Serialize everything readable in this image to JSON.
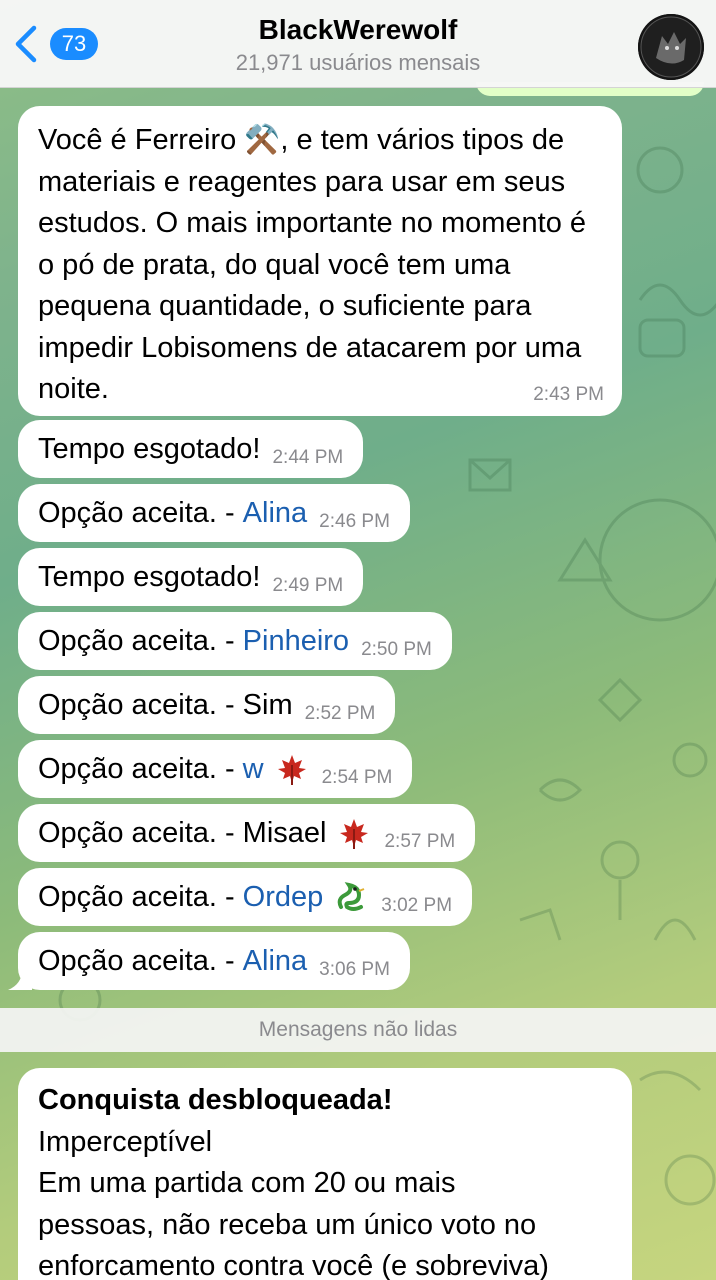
{
  "header": {
    "back_count": "73",
    "title": "BlackWerewolf",
    "subtitle": "21,971 usuários mensais"
  },
  "messages": [
    {
      "text": "Você é Ferreiro ⚒️, e tem vários tipos de materiais e reagentes para usar em seus estudos. O mais importante no momento é o pó de prata, do qual você tem uma pequena quantidade, o suficiente para impedir Lobisomens de atacarem por uma noite.",
      "time": "2:43 PM"
    },
    {
      "text": "Tempo esgotado!",
      "time": "2:44 PM"
    },
    {
      "text": "Opção aceita. -",
      "name": "Alina",
      "time": "2:46 PM"
    },
    {
      "text": "Tempo esgotado!",
      "time": "2:49 PM"
    },
    {
      "text": "Opção aceita. -",
      "name": "Pinheiro",
      "time": "2:50 PM"
    },
    {
      "text": "Opção aceita. -",
      "plain": "Sim",
      "time": "2:52 PM"
    },
    {
      "text": "Opção aceita. -",
      "name": "w",
      "emoji": "maple-leaf-icon",
      "time": "2:54 PM"
    },
    {
      "text": "Opção aceita. -",
      "plain": "Misael",
      "emoji": "maple-leaf-icon",
      "time": "2:57 PM"
    },
    {
      "text": "Opção aceita. -",
      "name": "Ordep",
      "emoji": "dragon-icon",
      "time": "3:02 PM"
    },
    {
      "text": "Opção aceita. -",
      "name": "Alina",
      "time": "3:06 PM"
    }
  ],
  "unread_label": "Mensagens não lidas",
  "last_message": {
    "title": "Conquista desbloqueada!",
    "line1": "Imperceptível",
    "line2": "Em uma partida com 20 ou mais",
    "line3": "pessoas, não receba um único voto no",
    "line4": "enforcamento contra você (e sobreviva)"
  },
  "colors": {
    "accent": "#1a8cff",
    "name_link": "#1b5fb0",
    "bubble": "#ffffff",
    "outgoing_bubble": "#e2ffc7",
    "time": "#8a8a8e"
  }
}
